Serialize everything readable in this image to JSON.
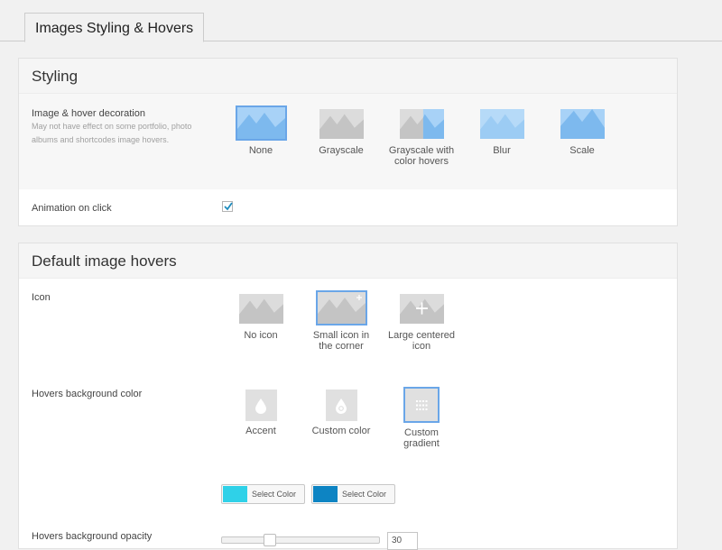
{
  "tab": {
    "label": "Images Styling & Hovers"
  },
  "styling": {
    "title": "Styling",
    "decoration": {
      "label": "Image & hover decoration",
      "description": "May not have effect on some portfolio, photo albums and shortcodes image hovers.",
      "options": [
        "None",
        "Grayscale",
        "Grayscale with color hovers",
        "Blur",
        "Scale"
      ],
      "selected": "None"
    },
    "animation": {
      "label": "Animation on click",
      "checked": true
    }
  },
  "hovers": {
    "title": "Default image hovers",
    "icon": {
      "label": "Icon",
      "options": [
        "No icon",
        "Small icon in the corner",
        "Large centered icon"
      ],
      "selected": "Small icon in the corner"
    },
    "bg_color": {
      "label": "Hovers background color",
      "options": [
        "Accent",
        "Custom color",
        "Custom gradient"
      ],
      "selected": "Custom gradient",
      "pickers": [
        {
          "label": "Select Color",
          "color": "#2fd1e8"
        },
        {
          "label": "Select Color",
          "color": "#0d84c3"
        }
      ]
    },
    "opacity": {
      "label": "Hovers background opacity",
      "value": "30"
    }
  },
  "colors": {
    "accent_blue": "#6aa6e8",
    "image_blue": "#a8d2f7",
    "mountain_blue": "#7db9ee"
  }
}
